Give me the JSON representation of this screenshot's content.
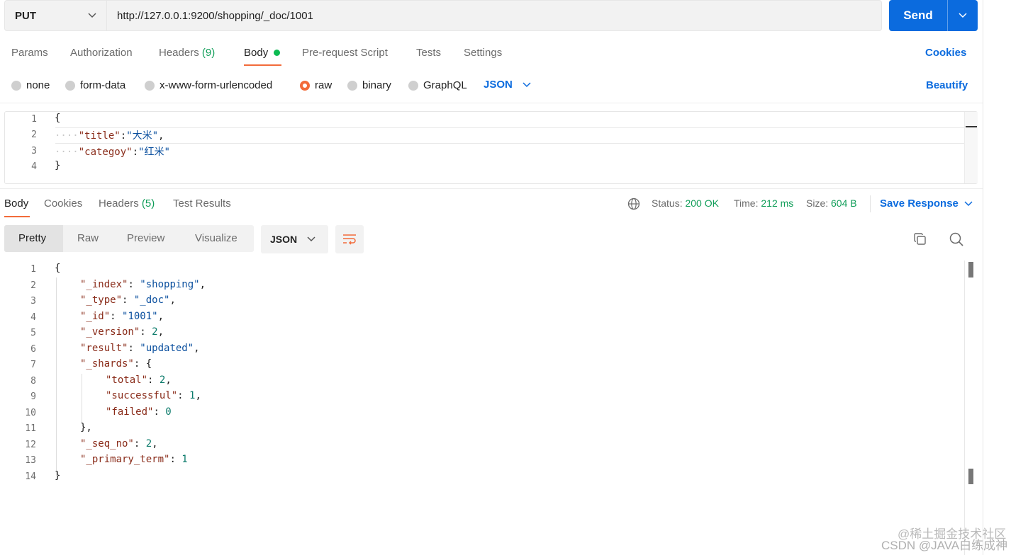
{
  "request": {
    "method": "PUT",
    "url": "http://127.0.0.1:9200/shopping/_doc/1001",
    "send_label": "Send"
  },
  "request_tabs": [
    {
      "label": "Params"
    },
    {
      "label": "Authorization"
    },
    {
      "label": "Headers",
      "count": "(9)"
    },
    {
      "label": "Body"
    },
    {
      "label": "Pre-request Script"
    },
    {
      "label": "Tests"
    },
    {
      "label": "Settings"
    }
  ],
  "cookies_label": "Cookies",
  "body_types": [
    {
      "label": "none"
    },
    {
      "label": "form-data"
    },
    {
      "label": "x-www-form-urlencoded"
    },
    {
      "label": "raw",
      "selected": true
    },
    {
      "label": "binary"
    },
    {
      "label": "GraphQL"
    }
  ],
  "raw_format": "JSON",
  "beautify_label": "Beautify",
  "request_body": {
    "line_numbers": [
      "1",
      "2",
      "3",
      "4"
    ],
    "open_brace": "{",
    "close_brace": "}",
    "whitespace": "····",
    "lines": [
      {
        "key": "\"title\"",
        "sep": ":",
        "value": "\"大米\"",
        "tail": ","
      },
      {
        "key": "\"categoy\"",
        "sep": ":",
        "value": "\"红米\"",
        "tail": ""
      }
    ]
  },
  "response_tabs": [
    {
      "label": "Body"
    },
    {
      "label": "Cookies"
    },
    {
      "label": "Headers",
      "count": "(5)"
    },
    {
      "label": "Test Results"
    }
  ],
  "response_status": {
    "status_label": "Status:",
    "status_value": "200 OK",
    "time_label": "Time:",
    "time_value": "212 ms",
    "size_label": "Size:",
    "size_value": "604 B"
  },
  "save_response_label": "Save Response",
  "view_modes": [
    "Pretty",
    "Raw",
    "Preview",
    "Visualize"
  ],
  "response_format": "JSON",
  "response_body": {
    "line_numbers": [
      "1",
      "2",
      "3",
      "4",
      "5",
      "6",
      "7",
      "8",
      "9",
      "10",
      "11",
      "12",
      "13",
      "14"
    ],
    "open_brace": "{",
    "close_brace": "}",
    "shards_close": "},",
    "index_key": "\"_index\"",
    "index_val": "\"shopping\"",
    "type_key": "\"_type\"",
    "type_val": "\"_doc\"",
    "id_key": "\"_id\"",
    "id_val": "\"1001\"",
    "version_key": "\"_version\"",
    "version_val": "2",
    "result_key": "\"result\"",
    "result_val": "\"updated\"",
    "shards_key": "\"_shards\"",
    "total_key": "\"total\"",
    "total_val": "2",
    "successful_key": "\"successful\"",
    "successful_val": "1",
    "failed_key": "\"failed\"",
    "failed_val": "0",
    "seq_key": "\"_seq_no\"",
    "seq_val": "2",
    "term_key": "\"_primary_term\"",
    "term_val": "1"
  },
  "watermark": {
    "line1": "@稀土掘金技术社区",
    "line2": "CSDN @JAVA白练成神"
  },
  "colors": {
    "accent": "#0b6bde",
    "tab_indicator": "#f26b3a",
    "success": "#0f9d58"
  }
}
